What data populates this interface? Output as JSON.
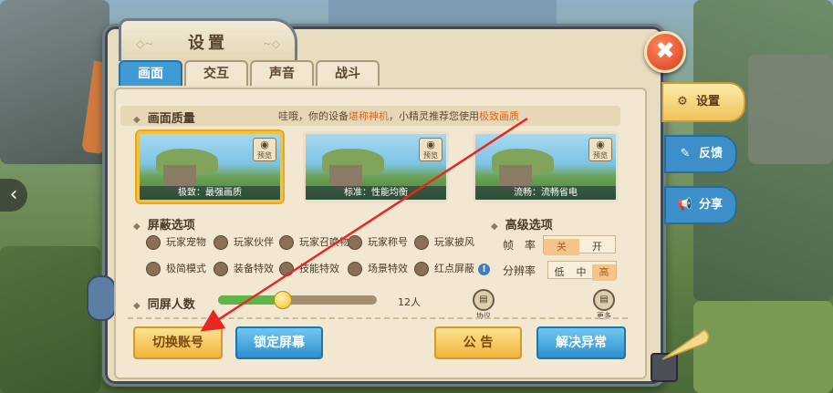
{
  "window": {
    "title": "设置"
  },
  "close": {
    "icon": "close-icon",
    "glyph": "✖"
  },
  "tabs": [
    {
      "label": "画面",
      "active": true
    },
    {
      "label": "交互",
      "active": false
    },
    {
      "label": "声音",
      "active": false
    },
    {
      "label": "战斗",
      "active": false
    }
  ],
  "quality": {
    "title": "画面质量",
    "recommend_prefix": "哇哦，你的设备",
    "recommend_device": "堪称神机",
    "recommend_middle": "，小精灵推荐您使用",
    "recommend_mode": "极致画质",
    "options": [
      {
        "caption": "极致：最强画质",
        "selected": true,
        "preview": "预览"
      },
      {
        "caption": "标准：性能均衡",
        "selected": false,
        "preview": "预览"
      },
      {
        "caption": "流畅：流畅省电",
        "selected": false,
        "preview": "预览"
      }
    ]
  },
  "shield": {
    "title": "屏蔽选项",
    "row1": [
      "玩家宠物",
      "玩家伙伴",
      "玩家召唤物",
      "玩家称号",
      "玩家披风"
    ],
    "row2": [
      "极简模式",
      "装备特效",
      "技能特效",
      "场景特效",
      "红点屏蔽"
    ],
    "info_glyph": "!"
  },
  "advanced": {
    "title": "高级选项",
    "fps": {
      "label": "帧　率",
      "options": [
        "关",
        "开"
      ],
      "selected": "关"
    },
    "resolution": {
      "label": "分辨率",
      "options": [
        "低",
        "中",
        "高"
      ],
      "selected": "高"
    }
  },
  "players": {
    "title": "同屏人数",
    "value_text": "12人",
    "fraction": 0.4
  },
  "icons_small": [
    {
      "name": "protocol",
      "label": "协议"
    },
    {
      "name": "more",
      "label": "更多"
    }
  ],
  "buttons": {
    "switch_account": "切换账号",
    "lock_screen": "锁定屏幕",
    "announcement": "公 告",
    "fix_issue": "解决异常"
  },
  "side_tabs": {
    "settings": "设置",
    "feedback": "反馈",
    "share": "分享"
  },
  "nav": {
    "left_arrow": "‹"
  },
  "colors": {
    "accent_blue": "#3f9bd6",
    "highlight_orange": "#e0661f",
    "annotation_red": "#e8251f"
  }
}
